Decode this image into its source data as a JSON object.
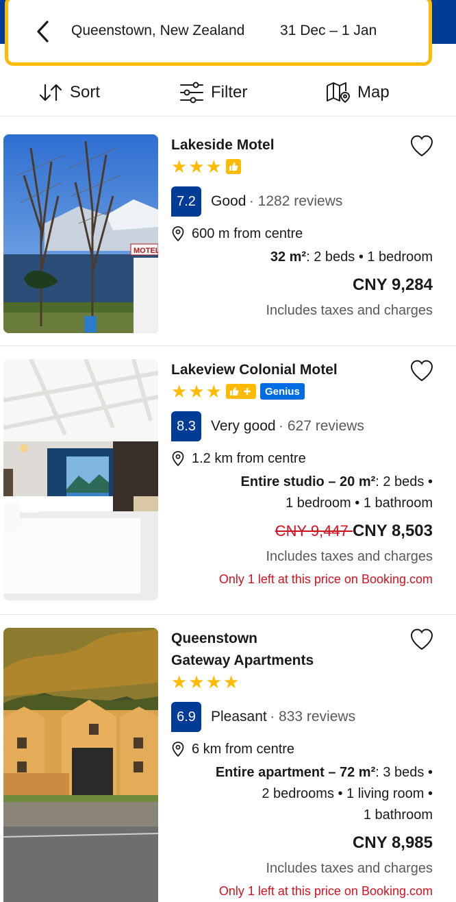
{
  "search": {
    "destination": "Queenstown, New Zealand",
    "dates": "31 Dec  –  1 Jan"
  },
  "toolbar": {
    "sort_label": "Sort",
    "filter_label": "Filter",
    "map_label": "Map"
  },
  "colors": {
    "brand_blue": "#003b95",
    "search_border": "#febb02",
    "star": "#febb02",
    "genius": "#006ce4",
    "alert_red": "#d4111e"
  },
  "hotels": [
    {
      "name": "Lakeside Motel",
      "stars": 3,
      "score": "7.2",
      "rating_label": "Good",
      "reviews": "· 1282 reviews",
      "distance": "600 m from centre",
      "unit_bold": "32 m²",
      "unit_rest": ": 2 beds • 1 bedroom",
      "price": "CNY 9,284",
      "taxes": "Includes taxes and charges"
    },
    {
      "name": "Lakeview Colonial Motel",
      "stars": 3,
      "genius_label": "Genius",
      "score": "8.3",
      "rating_label": "Very good",
      "reviews": "· 627 reviews",
      "distance": "1.2 km from centre",
      "unit_bold": "Entire studio – 20 m²",
      "unit_rest": ": 2 beds •",
      "unit_line2": "1 bedroom • 1 bathroom",
      "old_price": "CNY 9,447 ",
      "price": "CNY 8,503",
      "taxes": "Includes taxes and charges",
      "availability": "Only 1 left at this price on Booking.com"
    },
    {
      "name_line1": "Queenstown",
      "name_line2": "Gateway Apartments",
      "stars": 4,
      "score": "6.9",
      "rating_label": "Pleasant",
      "reviews": "· 833 reviews",
      "distance": "6 km from centre",
      "unit_bold": "Entire apartment – 72 m²",
      "unit_rest": ": 3 beds •",
      "unit_line2": "2 bedrooms • 1 living room •",
      "unit_line3": "1 bathroom",
      "price": "CNY 8,985",
      "taxes": "Includes taxes and charges",
      "availability": "Only 1 left at this price on Booking.com"
    }
  ]
}
